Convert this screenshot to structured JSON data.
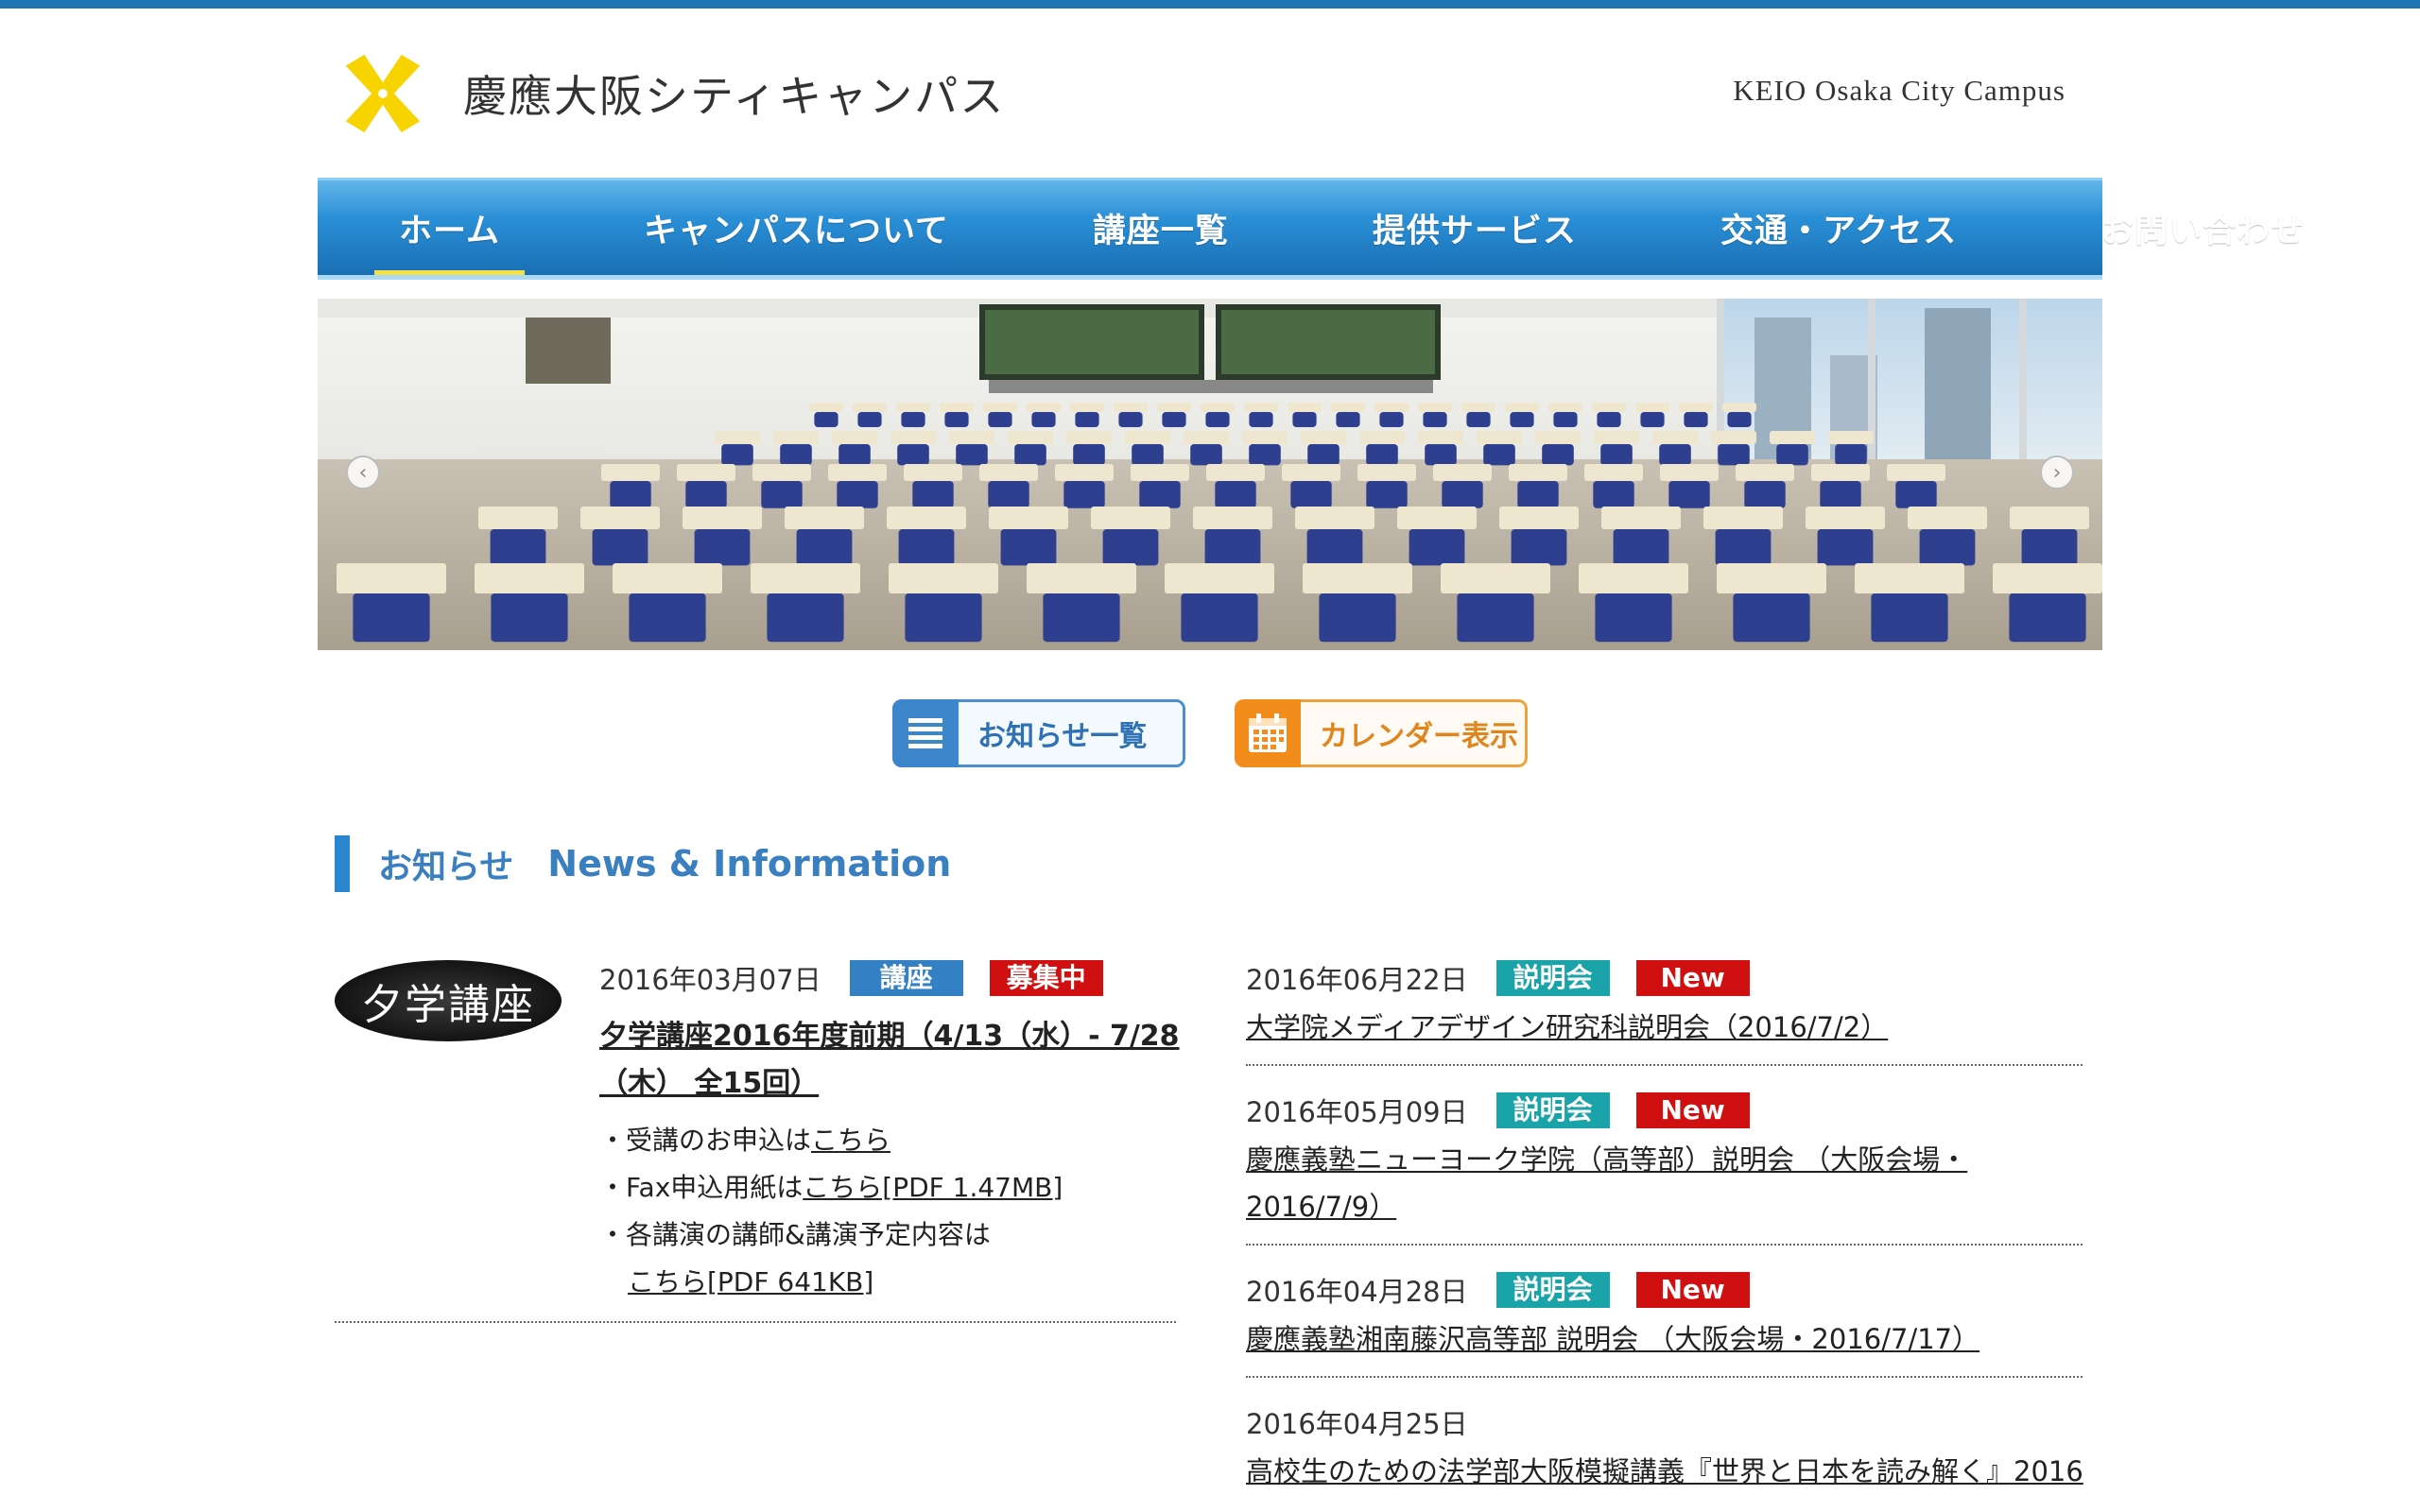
{
  "header": {
    "title_jp": "慶應大阪シティキャンパス",
    "title_en": "KEIO Osaka City Campus",
    "logo_color": "#f7d400"
  },
  "nav": {
    "items": [
      {
        "label": "ホーム",
        "active": true
      },
      {
        "label": "キャンパスについて",
        "active": false
      },
      {
        "label": "講座一覧",
        "active": false
      },
      {
        "label": "提供サービス",
        "active": false
      },
      {
        "label": "交通・アクセス",
        "active": false
      },
      {
        "label": "お問い合わせ",
        "active": false
      }
    ]
  },
  "buttons": {
    "news_list": "お知らせ一覧",
    "calendar": "カレンダー表示"
  },
  "section": {
    "title_jp": "お知らせ",
    "title_en": "News & Information"
  },
  "featured": {
    "thumb_text": "夕学講座",
    "date": "2016年03月07日",
    "tags": [
      "講座",
      "募集中"
    ],
    "title": "夕学講座2016年度前期（4/13（水）- 7/28（木） 全15回）",
    "lines": [
      {
        "prefix": "・受講のお申込は",
        "link": "こちら"
      },
      {
        "prefix": "・Fax申込用紙は",
        "link": "こちら[PDF 1.47MB]"
      },
      {
        "prefix": "・各講演の講師&講演予定内容は",
        "link": "こちら[PDF 641KB]"
      }
    ]
  },
  "news": [
    {
      "date": "2016年06月22日",
      "tag": "説明会",
      "new": "New",
      "title": "大学院メディアデザイン研究科説明会（2016/7/2）"
    },
    {
      "date": "2016年05月09日",
      "tag": "説明会",
      "new": "New",
      "title": "慶應義塾ニューヨーク学院（高等部）説明会 （大阪会場・2016/7/9）"
    },
    {
      "date": "2016年04月28日",
      "tag": "説明会",
      "new": "New",
      "title": "慶應義塾湘南藤沢高等部 説明会 （大阪会場・2016/7/17）"
    },
    {
      "date": "2016年04月25日",
      "tag": "",
      "new": "",
      "title": "高校生のための法学部大阪模擬講義『世界と日本を読み解く』2016"
    }
  ]
}
